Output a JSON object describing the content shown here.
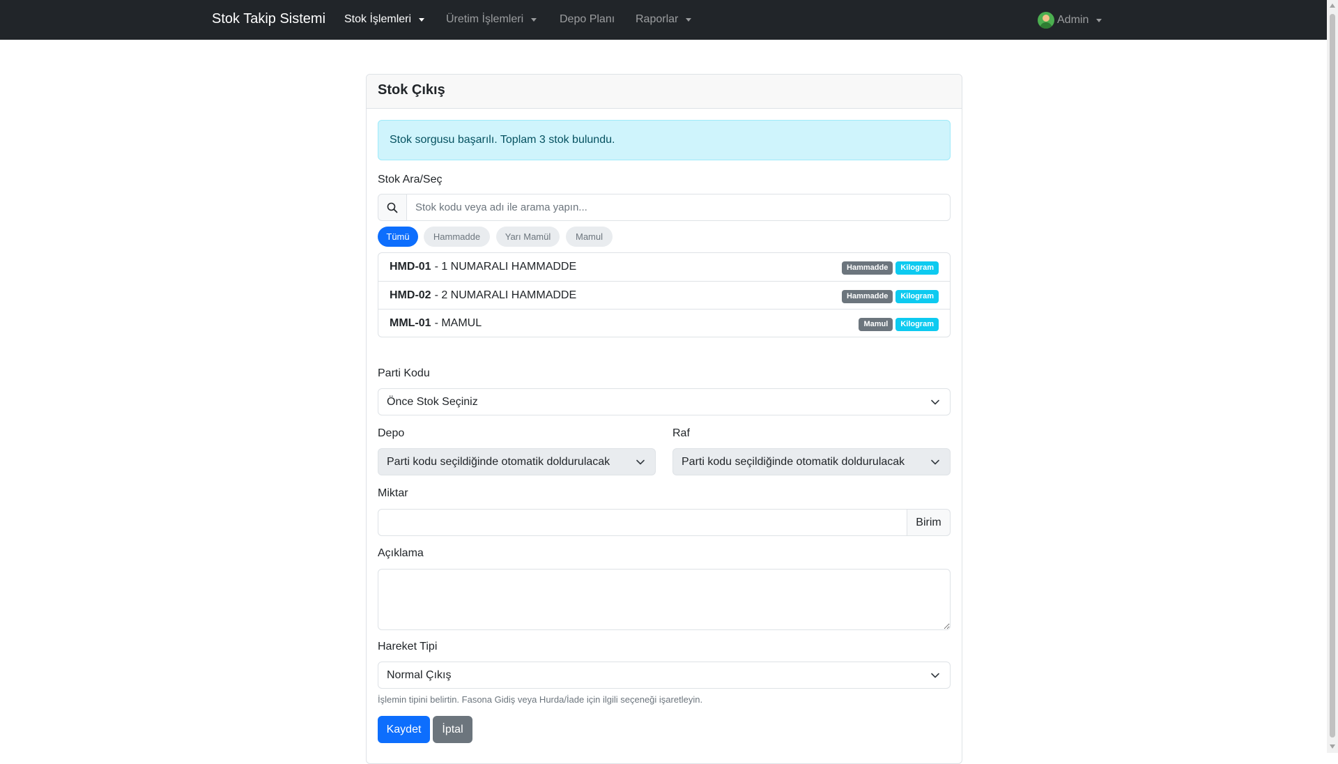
{
  "navbar": {
    "brand": "Stok Takip Sistemi",
    "items": [
      {
        "label": "Stok İşlemleri",
        "dropdown": true,
        "active": true
      },
      {
        "label": "Üretim İşlemleri",
        "dropdown": true,
        "active": false
      },
      {
        "label": "Depo Planı",
        "dropdown": false,
        "active": false
      },
      {
        "label": "Raporlar",
        "dropdown": true,
        "active": false
      }
    ],
    "user": "Admin"
  },
  "card": {
    "title": "Stok Çıkış",
    "alert": "Stok sorgusu başarılı. Toplam 3 stok bulundu.",
    "search": {
      "label": "Stok Ara/Seç",
      "placeholder": "Stok kodu veya adı ile arama yapın..."
    },
    "filters": [
      "Tümü",
      "Hammadde",
      "Yarı Mamül",
      "Mamul"
    ],
    "stocks": [
      {
        "code": "HMD-01",
        "name": "- 1 NUMARALI HAMMADDE",
        "type": "Hammadde",
        "unit": "Kilogram"
      },
      {
        "code": "HMD-02",
        "name": "- 2 NUMARALI HAMMADDE",
        "type": "Hammadde",
        "unit": "Kilogram"
      },
      {
        "code": "MML-01",
        "name": "- MAMUL",
        "type": "Mamul",
        "unit": "Kilogram"
      }
    ],
    "parti": {
      "label": "Parti Kodu",
      "value": "Önce Stok Seçiniz"
    },
    "depo": {
      "label": "Depo",
      "value": "Parti kodu seçildiğinde otomatik doldurulacak"
    },
    "raf": {
      "label": "Raf",
      "value": "Parti kodu seçildiğinde otomatik doldurulacak"
    },
    "miktar": {
      "label": "Miktar",
      "value": "",
      "unit": "Birim"
    },
    "aciklama": {
      "label": "Açıklama",
      "value": ""
    },
    "hareket": {
      "label": "Hareket Tipi",
      "value": "Normal Çıkış",
      "help": "İşlemin tipini belirtin. Fasona Gidiş veya Hurda/İade için ilgili seçeneği işaretleyin."
    },
    "buttons": {
      "save": "Kaydet",
      "cancel": "İptal"
    }
  },
  "colors": {
    "navbar_bg": "#212529",
    "primary": "#0d6efd",
    "secondary": "#6c757d",
    "info_bg": "#cff4fc",
    "info_text": "#055160",
    "badge_cyan": "#0dcaf0"
  },
  "icons": [
    "search-icon",
    "chevron-down-icon",
    "user-avatar-icon",
    "caret-down-icon"
  ]
}
